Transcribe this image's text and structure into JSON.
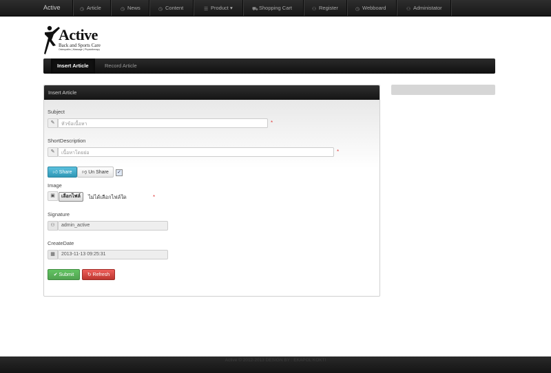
{
  "topnav": {
    "brand": "Active",
    "items": [
      {
        "label": "Article",
        "icon": "clock-icon"
      },
      {
        "label": "News",
        "icon": "clock-icon"
      },
      {
        "label": "Content",
        "icon": "clock-icon"
      },
      {
        "label": "Product",
        "icon": "list-icon",
        "caret": "▾"
      },
      {
        "label": "Shopping Cart",
        "icon": "cart-icon"
      },
      {
        "label": "Register",
        "icon": "user-icon"
      },
      {
        "label": "Webboard",
        "icon": "clock-icon"
      },
      {
        "label": "Administator",
        "icon": "user-icon"
      }
    ]
  },
  "logo": {
    "word": "Active",
    "tagline": "Back and Sports Care",
    "subtagline": "Osteopaths | Massage | Physiotherapy"
  },
  "subnav": {
    "tabs": [
      {
        "label": "Insert Article",
        "active": true
      },
      {
        "label": "Record Article",
        "active": false
      }
    ]
  },
  "form": {
    "title": "Insert Article",
    "subject": {
      "label": "Subject",
      "placeholder": "หัวข้อเนื้อหา"
    },
    "short_description": {
      "label": "ShortDescription",
      "placeholder": "เนื้อหาโดยย่อ"
    },
    "share_label": "Share",
    "unshare_label": "Un Share",
    "image": {
      "label": "Image",
      "file_button": "เลือกไฟล์",
      "file_status": "ไม่ได้เลือกไฟล์ใด"
    },
    "signature": {
      "label": "Signature",
      "value": "admin_active"
    },
    "create_date": {
      "label": "CreateDate",
      "value": "2013-11-13  09:25:31"
    },
    "submit_label": "Submit",
    "refresh_label": "Refresh",
    "required_mark": "*"
  },
  "footer": {
    "text": "Active © 2012-2013 DESIGN BY : EKAPOL KOKTI"
  },
  "colors": {
    "share": "#2f96b4",
    "submit": "#51a351",
    "refresh": "#bd362f",
    "required": "#e04040"
  }
}
